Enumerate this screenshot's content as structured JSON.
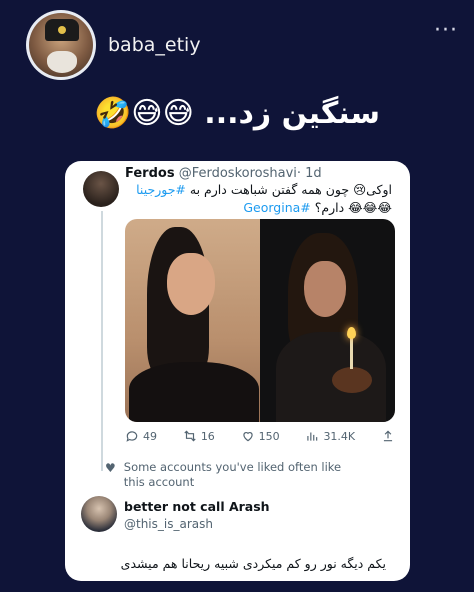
{
  "story": {
    "username": "baba_etiy",
    "caption": "سنگین زد... 😅😅🤣",
    "more_label": "···"
  },
  "tweet": {
    "author_name": "Ferdos",
    "author_handle": "@Ferdoskoroshavi",
    "time": "· 1d",
    "text_line1": "اوکی😢 چون همه گفتن شباهت دارم به ",
    "hashtag1": "#جورجینا",
    "text_line2": "😂😂😂 دارم؟",
    "hashtag2": "#Georgina",
    "stats": {
      "replies": "49",
      "retweets": "16",
      "likes": "150",
      "views": "31.4K"
    }
  },
  "liked_notice": "Some accounts you've liked often like this account",
  "reply": {
    "author_name": "better not call Arash",
    "author_handle": "@this_is_arash",
    "text": "یکم دیگه نور رو کم میکردی شبیه ریحانا هم میشدی"
  },
  "colors": {
    "background": "#0f1438",
    "card": "#ffffff",
    "link": "#1d9bf0",
    "muted": "#536471"
  }
}
